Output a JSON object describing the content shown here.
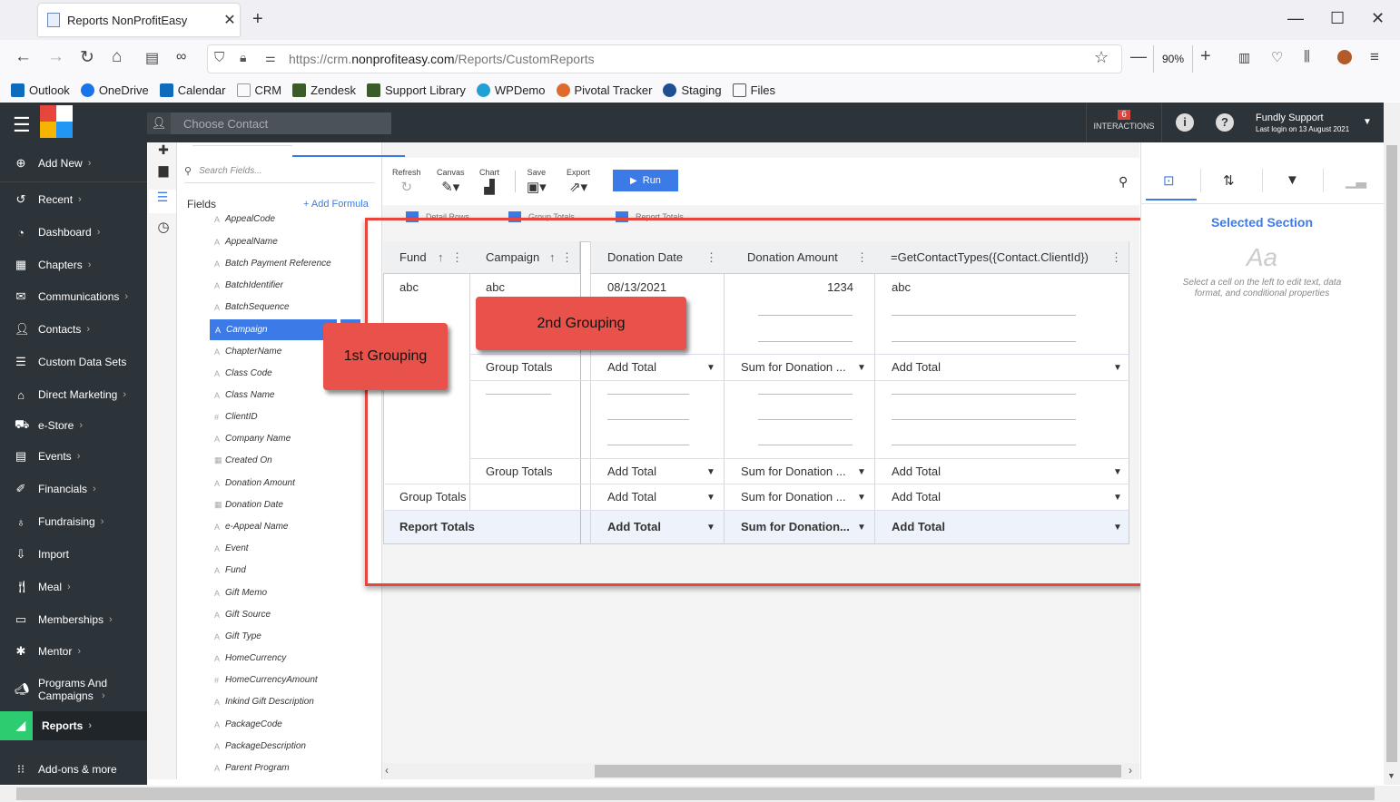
{
  "browser": {
    "tab_title": "Reports NonProfitEasy",
    "url_prefix": "https://crm.",
    "url_domain": "nonprofiteasy.com",
    "url_path": "/Reports/CustomReports",
    "zoom": "90%",
    "bookmarks": [
      {
        "label": "Outlook",
        "color": "#0f6cbd"
      },
      {
        "label": "OneDrive",
        "color": "#1a73e8"
      },
      {
        "label": "Calendar",
        "color": "#0f6cbd"
      },
      {
        "label": "CRM",
        "color": "#ffffff"
      },
      {
        "label": "Zendesk",
        "color": "#3b5b2a"
      },
      {
        "label": "Support Library",
        "color": "#3b5b2a"
      },
      {
        "label": "WPDemo",
        "color": "#21a0d6"
      },
      {
        "label": "Pivotal Tracker",
        "color": "#e06a2b"
      },
      {
        "label": "Staging",
        "color": "#1d4f91"
      },
      {
        "label": "Files",
        "color": "#ffffff"
      }
    ]
  },
  "header": {
    "contact_placeholder": "Choose Contact",
    "interactions_count": "6",
    "interactions_label": "INTERACTIONS",
    "user_name": "Fundly Support",
    "last_login": "Last login on 13 August 2021"
  },
  "nav": [
    {
      "label": "Add New",
      "icon": "plus-circle-icon"
    },
    {
      "label": "Recent",
      "icon": "history-icon"
    },
    {
      "label": "Dashboard",
      "icon": "gauge-icon"
    },
    {
      "label": "Chapters",
      "icon": "grid-icon"
    },
    {
      "label": "Communications",
      "icon": "envelope-icon"
    },
    {
      "label": "Contacts",
      "icon": "person-icon"
    },
    {
      "label": "Custom Data Sets",
      "icon": "database-icon"
    },
    {
      "label": "Direct Marketing",
      "icon": "bank-icon"
    },
    {
      "label": "e-Store",
      "icon": "cart-icon"
    },
    {
      "label": "Events",
      "icon": "calendar-icon"
    },
    {
      "label": "Financials",
      "icon": "money-icon"
    },
    {
      "label": "Fundraising",
      "icon": "moneybag-icon"
    },
    {
      "label": "Import",
      "icon": "import-icon"
    },
    {
      "label": "Meal",
      "icon": "utensils-icon"
    },
    {
      "label": "Memberships",
      "icon": "id-card-icon"
    },
    {
      "label": "Mentor",
      "icon": "mentor-icon"
    },
    {
      "label": "Programs And Campaigns",
      "icon": "megaphone-icon"
    },
    {
      "label": "Reports",
      "icon": "chart-icon"
    },
    {
      "label": "Add-ons & more",
      "icon": "apps-icon"
    }
  ],
  "fields_panel": {
    "search_placeholder": "Search Fields...",
    "title": "Fields",
    "add_formula": "+ Add Formula",
    "fields": [
      {
        "label": "AppealCode",
        "type": "A"
      },
      {
        "label": "AppealName",
        "type": "A"
      },
      {
        "label": "Batch Payment Reference",
        "type": "A"
      },
      {
        "label": "BatchIdentifier",
        "type": "A"
      },
      {
        "label": "BatchSequence",
        "type": "A"
      },
      {
        "label": "Campaign",
        "type": "A"
      },
      {
        "label": "ChapterName",
        "type": "A"
      },
      {
        "label": "Class Code",
        "type": "A"
      },
      {
        "label": "Class Name",
        "type": "A"
      },
      {
        "label": "ClientID",
        "type": "#"
      },
      {
        "label": "Company Name",
        "type": "A"
      },
      {
        "label": "Created On",
        "type": "▦"
      },
      {
        "label": "Donation Amount",
        "type": "A"
      },
      {
        "label": "Donation Date",
        "type": "▦"
      },
      {
        "label": "e-Appeal Name",
        "type": "A"
      },
      {
        "label": "Event",
        "type": "A"
      },
      {
        "label": "Fund",
        "type": "A"
      },
      {
        "label": "Gift Memo",
        "type": "A"
      },
      {
        "label": "Gift Source",
        "type": "A"
      },
      {
        "label": "Gift Type",
        "type": "A"
      },
      {
        "label": "HomeCurrency",
        "type": "A"
      },
      {
        "label": "HomeCurrencyAmount",
        "type": "#"
      },
      {
        "label": "Inkind Gift Description",
        "type": "A"
      },
      {
        "label": "PackageCode",
        "type": "A"
      },
      {
        "label": "PackageDescription",
        "type": "A"
      },
      {
        "label": "Parent Program",
        "type": "A"
      }
    ]
  },
  "toolbar": {
    "refresh": "Refresh",
    "canvas": "Canvas",
    "chart": "Chart",
    "save": "Save",
    "export": "Export",
    "run": "Run",
    "toggles": [
      "Detail Rows",
      "Group Totals",
      "Report Totals"
    ]
  },
  "grid": {
    "headers": [
      "Fund",
      "Campaign",
      "Donation Date",
      "Donation Amount",
      "=GetContactTypes({Contact.ClientId})"
    ],
    "row1": [
      "abc",
      "abc",
      "08/13/2021",
      "1234",
      "abc"
    ],
    "group_totals": "Group Totals",
    "add_total": "Add Total",
    "sum_donation": "Sum for Donation ...",
    "report_totals": "Report Totals",
    "report_sum": "Sum for Donation..."
  },
  "callouts": {
    "first": "1st Grouping",
    "second": "2nd Grouping"
  },
  "right_panel": {
    "title": "Selected Section",
    "aa": "Aa",
    "hint": "Select a cell on the left to edit text, data format, and conditional properties"
  }
}
